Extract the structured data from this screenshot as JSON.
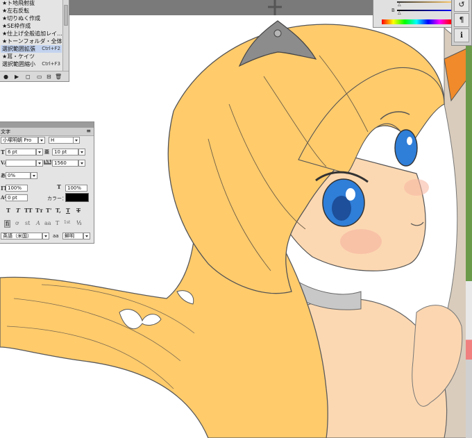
{
  "actions_panel": {
    "items": [
      {
        "label": "★ト地飛射抜",
        "shortcut": ""
      },
      {
        "label": "★左右反転",
        "shortcut": ""
      },
      {
        "label": "★切りぬく作成",
        "shortcut": ""
      },
      {
        "label": "★SE枠作成",
        "shortcut": ""
      },
      {
        "label": "★仕上げ全般追加レイ...",
        "shortcut": ""
      },
      {
        "label": "★トーンフォルダ・全体sh...",
        "shortcut": ""
      },
      {
        "label": "選択範囲拡張",
        "shortcut": "Ctrl+F2"
      },
      {
        "label": "★耳・ケイツ",
        "shortcut": ""
      },
      {
        "label": "選択範囲縮小",
        "shortcut": "Ctrl+F3"
      }
    ],
    "footer": [
      "●",
      "▶",
      "◻",
      "▭",
      "⊟",
      "🗑"
    ]
  },
  "character_panel": {
    "tab": "文字",
    "font_family": "小塚明朝 Pro",
    "font_style": "H",
    "font_size": "6 pt",
    "leading": "10 pt",
    "kerning": "",
    "tracking": "1560",
    "tsume": "0%",
    "vertical_scale": "100%",
    "horizontal_scale": "100%",
    "baseline_shift": "0 pt",
    "color_label": "カラー：",
    "style_buttons": [
      "T",
      "T",
      "TT",
      "Tт",
      "T'",
      "T,",
      "T",
      "T"
    ],
    "opentype_buttons": [
      "fi",
      "ơ",
      "st",
      "A",
      "aa",
      "T",
      "1st",
      "½"
    ],
    "language": "英語（米国）",
    "aa_label": "aa",
    "antialias": "鮮明"
  },
  "color_panel": {
    "b_label": "B"
  },
  "dock": {
    "buttons": [
      "↺",
      "¶",
      "ℹ"
    ]
  },
  "colors": {
    "hair": "#ffcb6b",
    "skin": "#fcd8b2",
    "eye": "#2f7ed8",
    "line": "#555555",
    "tiara": "#8c8c8c",
    "panel_bg": "#e4e4e4"
  }
}
